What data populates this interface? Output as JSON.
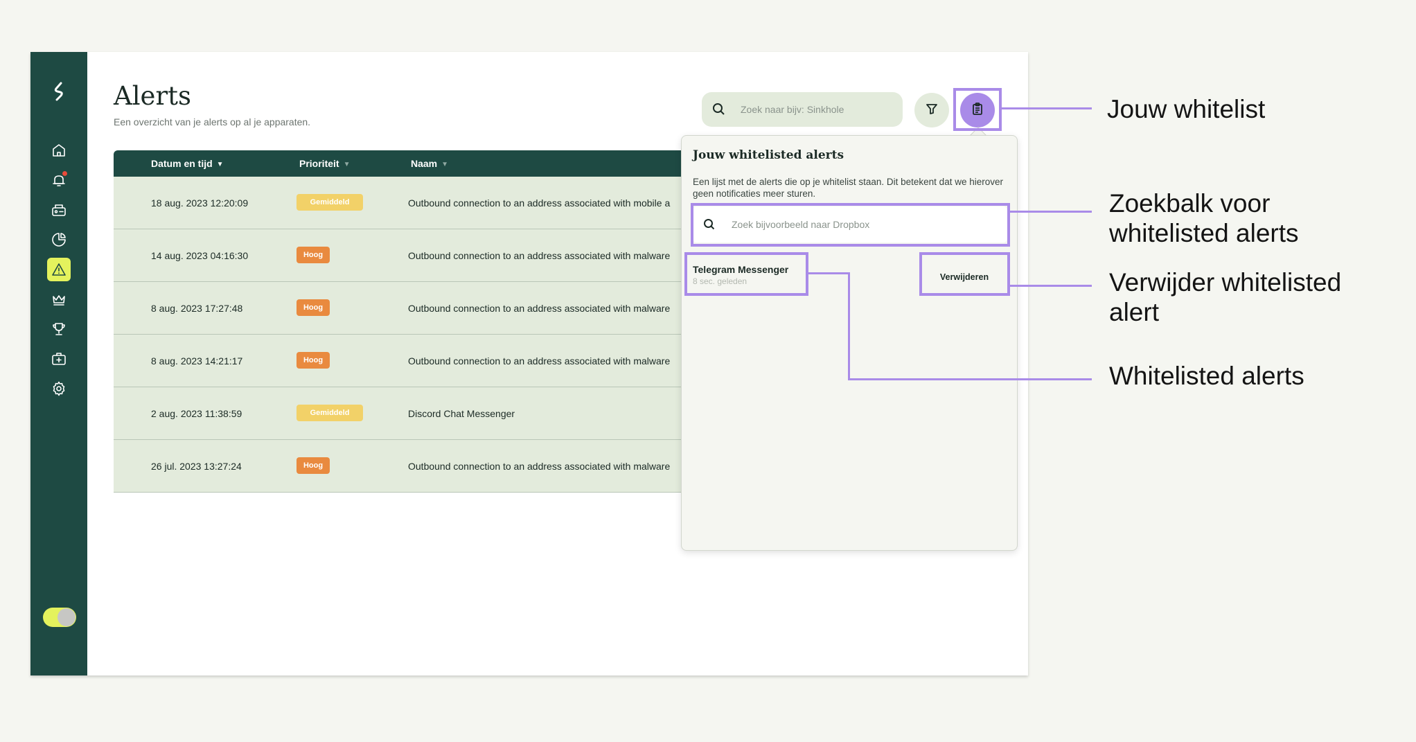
{
  "page": {
    "title": "Alerts",
    "subtitle": "Een overzicht van je alerts op al je apparaten."
  },
  "search": {
    "placeholder": "Zoek naar bijv: Sinkhole"
  },
  "table": {
    "columns": [
      "Datum en tijd",
      "Prioriteit",
      "Naam"
    ],
    "rows": [
      {
        "date": "18 aug. 2023 12:20:09",
        "priority": "Gemiddeld",
        "name": "Outbound connection to an address associated with mobile a"
      },
      {
        "date": "14 aug. 2023 04:16:30",
        "priority": "Hoog",
        "name": "Outbound connection to an address associated with malware"
      },
      {
        "date": "8 aug. 2023 17:27:48",
        "priority": "Hoog",
        "name": "Outbound connection to an address associated with malware"
      },
      {
        "date": "8 aug. 2023 14:21:17",
        "priority": "Hoog",
        "name": "Outbound connection to an address associated with malware"
      },
      {
        "date": "2 aug. 2023 11:38:59",
        "priority": "Gemiddeld",
        "name": "Discord Chat Messenger"
      },
      {
        "date": "26 jul. 2023 13:27:24",
        "priority": "Hoog",
        "name": "Outbound connection to an address associated with malware"
      }
    ]
  },
  "whitelist_panel": {
    "title": "Jouw whitelisted alerts",
    "description": "Een lijst met de alerts die op je whitelist staan. Dit betekent dat we hierover geen notificaties meer sturen.",
    "search_placeholder": "Zoek bijvoorbeeld naar Dropbox",
    "items": [
      {
        "name": "Telegram Messenger",
        "time": "8 sec. geleden",
        "action": "Verwijderen"
      }
    ]
  },
  "annotations": {
    "whitelist_button": "Jouw whitelist",
    "search_bar": "Zoekbalk voor\nwhitelisted alerts",
    "remove": "Verwijder whitelisted\nalert",
    "items": "Whitelisted alerts"
  },
  "colors": {
    "sidebar": "#1e4a43",
    "accent_lime": "#e4f25d",
    "highlight_purple": "#a98be8",
    "badge_medium": "#f2d168",
    "badge_high": "#e98a3f",
    "row_bg": "#e3ebdc"
  },
  "icons": [
    "logo-icon",
    "home-icon",
    "bell-icon",
    "devices-icon",
    "pie-chart-icon",
    "alert-triangle-icon",
    "crown-icon",
    "trophy-icon",
    "first-aid-icon",
    "gear-icon",
    "search-icon",
    "filter-icon",
    "clipboard-icon"
  ]
}
